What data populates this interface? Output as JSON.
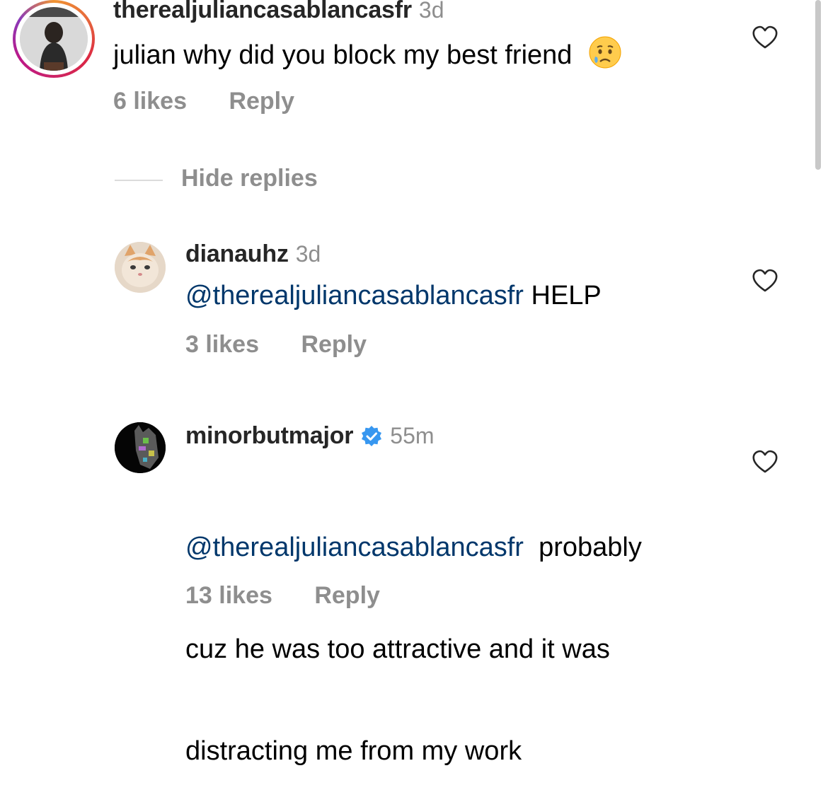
{
  "comment": {
    "username": "therealjuliancasablancasfr",
    "time": "3d",
    "text": "julian why did you block my best friend",
    "likes": "6 likes",
    "reply": "Reply"
  },
  "hide_replies": "Hide replies",
  "replies": [
    {
      "username": "dianauhz",
      "time": "3d",
      "mention": "@therealjuliancasablancasfr",
      "text": " HELP",
      "likes": "3 likes",
      "reply": "Reply"
    },
    {
      "username": "minorbutmajor",
      "time": "55m",
      "verified": true,
      "mention": "@therealjuliancasablancasfr",
      "text_line1": "  probably",
      "text_line2": "cuz he was too attractive and it was",
      "text_line3": "distracting me from my work",
      "likes": "13 likes",
      "reply": "Reply"
    }
  ],
  "icons": {
    "heart": "heart-outline-icon",
    "verified": "verified-badge-icon",
    "emoji": "crying-face-emoji"
  },
  "colors": {
    "mention": "#00376b",
    "secondary": "#8e8e8e",
    "verified": "#3797f0"
  }
}
